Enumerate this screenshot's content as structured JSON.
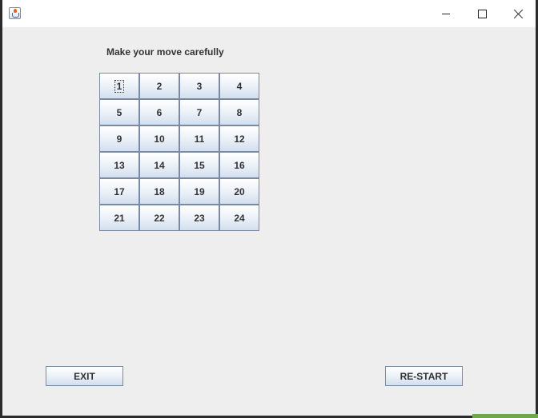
{
  "window": {
    "title": "",
    "controls": {
      "minimize": "minimize",
      "maximize": "maximize",
      "close": "close"
    }
  },
  "prompt": "Make your move carefully",
  "board": {
    "cells": [
      "1",
      "2",
      "3",
      "4",
      "5",
      "6",
      "7",
      "8",
      "9",
      "10",
      "11",
      "12",
      "13",
      "14",
      "15",
      "16",
      "17",
      "18",
      "19",
      "20",
      "21",
      "22",
      "23",
      "24"
    ],
    "focused_cell": "1"
  },
  "buttons": {
    "exit": "EXIT",
    "restart": "RE-START"
  }
}
